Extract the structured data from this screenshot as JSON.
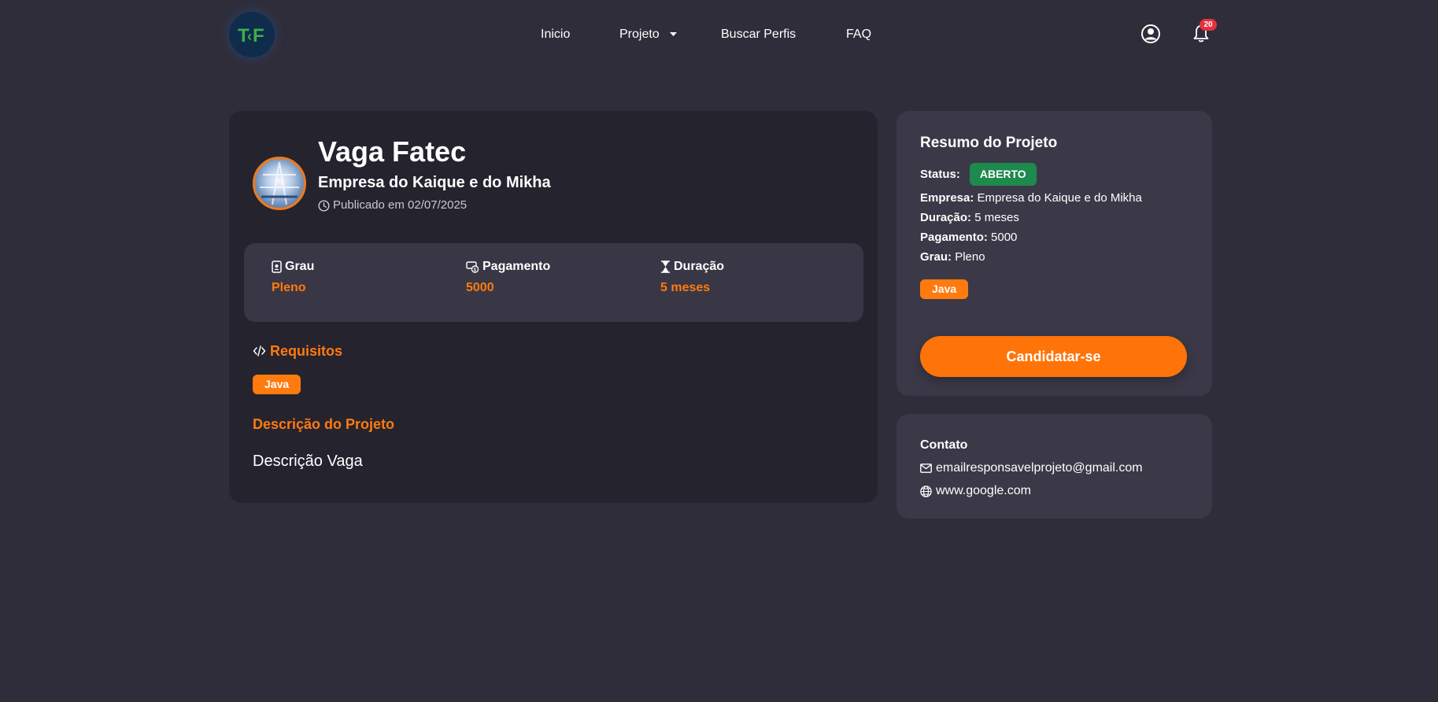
{
  "nav": {
    "logo_text": "TF",
    "links": [
      "Inicio",
      "Projeto",
      "Buscar Perfis",
      "FAQ"
    ],
    "notification_count": "20"
  },
  "project": {
    "title": "Vaga Fatec",
    "company": "Empresa do Kaique e do Mikha",
    "published": "Publicado em 02/07/2025",
    "stats": {
      "grau_label": "Grau",
      "grau_value": "Pleno",
      "pagamento_label": "Pagamento",
      "pagamento_value": "5000",
      "duracao_label": "Duração",
      "duracao_value": "5 meses"
    },
    "requirements_heading": "Requisitos",
    "requirements": [
      "Java"
    ],
    "description_heading": "Descrição do Projeto",
    "description": "Descrição Vaga"
  },
  "summary": {
    "title": "Resumo do Projeto",
    "status_label": "Status:",
    "status_value": "ABERTO",
    "empresa_label": "Empresa:",
    "empresa_value": "Empresa do Kaique e do Mikha",
    "duracao_label": "Duração:",
    "duracao_value": "5 meses",
    "pagamento_label": "Pagamento:",
    "pagamento_value": "5000",
    "grau_label": "Grau:",
    "grau_value": "Pleno",
    "tags": [
      "Java"
    ],
    "apply_label": "Candidatar-se"
  },
  "contact": {
    "title": "Contato",
    "email": "emailresponsavelprojeto@gmail.com",
    "website": "www.google.com"
  },
  "colors": {
    "background": "#2f2d3a",
    "accent": "#ff7a0f",
    "status_open": "#1e8a4e",
    "notification": "#e8303f"
  }
}
